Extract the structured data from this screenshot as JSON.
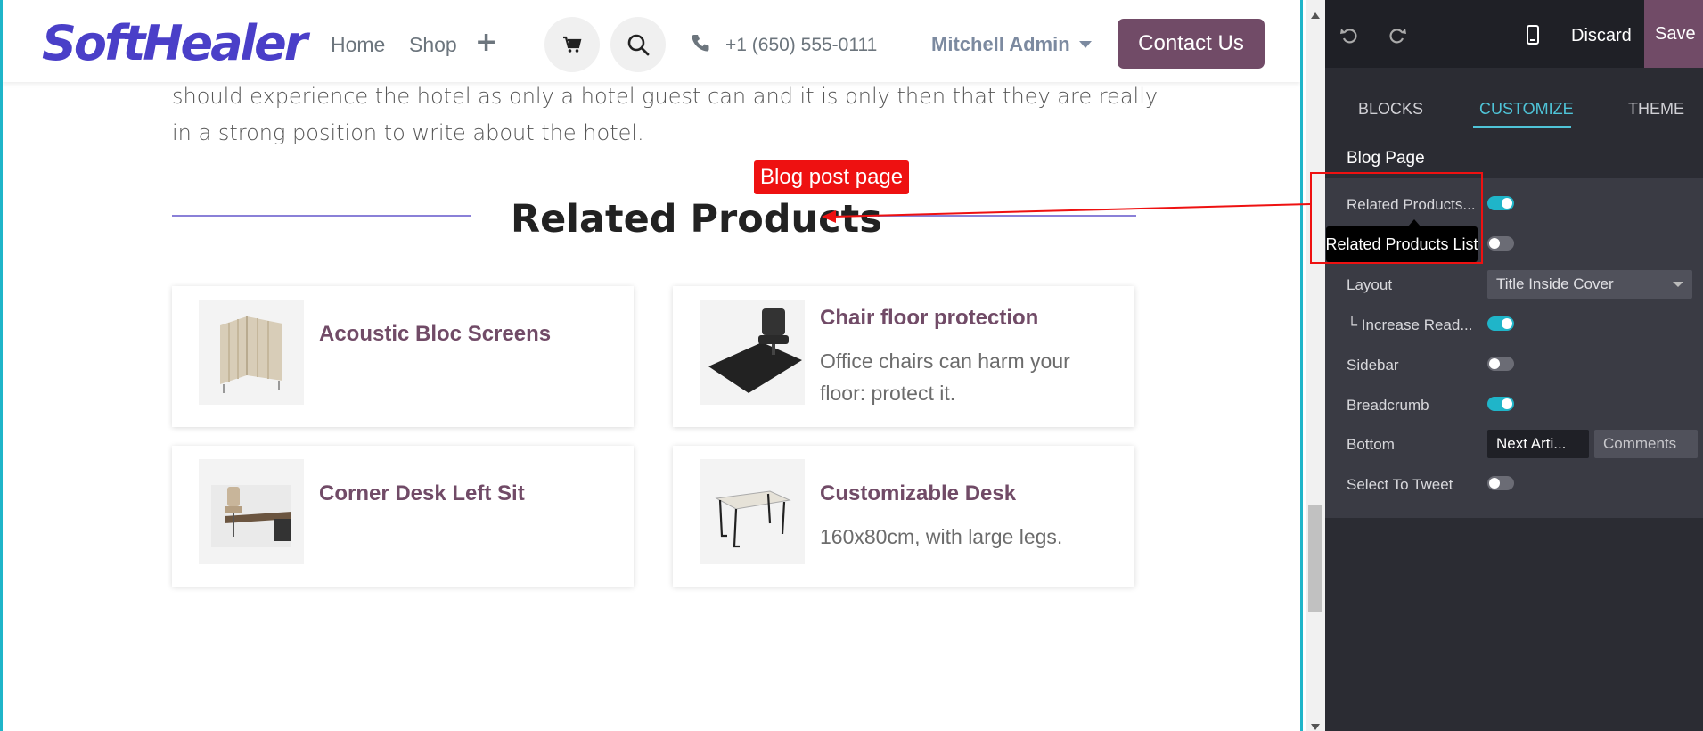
{
  "site": {
    "logo": "SoftHealer",
    "nav": {
      "home": "Home",
      "shop": "Shop",
      "phone": "+1 (650) 555-0111",
      "user": "Mitchell Admin",
      "contact": "Contact Us"
    },
    "paragraph": "should experience the hotel as only a hotel guest can and it is only then that they are really in a strong position to write about the hotel.",
    "related_title": "Related Products",
    "products": [
      {
        "title": "Acoustic Bloc Screens",
        "desc": ""
      },
      {
        "title": "Chair floor protection",
        "desc": "Office chairs can harm your floor: protect it."
      },
      {
        "title": "Corner Desk Left Sit",
        "desc": ""
      },
      {
        "title": "Customizable Desk",
        "desc": "160x80cm, with large legs."
      }
    ]
  },
  "editor": {
    "discard": "Discard",
    "save": "Save",
    "tabs": {
      "blocks": "BLOCKS",
      "customize": "CUSTOMIZE",
      "theme": "THEME"
    },
    "section_title": "Blog Page",
    "options": {
      "related_products": "Related Products...",
      "layout": "Layout",
      "layout_value": "Title Inside Cover",
      "increase_read": "└ Increase Read...",
      "sidebar": "Sidebar",
      "breadcrumb": "Breadcrumb",
      "bottom": "Bottom",
      "bottom_active": "Next Arti...",
      "bottom_inactive": "Comments",
      "select_to_tweet": "Select To Tweet"
    },
    "toggles": {
      "related_products": true,
      "hidden_option": false,
      "increase_read": true,
      "sidebar": false,
      "breadcrumb": true,
      "select_to_tweet": false
    },
    "tooltip": "Related Products List"
  },
  "annotation": {
    "label": "Blog post page",
    "color": "#ee1111"
  },
  "colors": {
    "brand": "#714b67",
    "accent": "#1fb5c9",
    "logo": "#4a3fc8"
  }
}
